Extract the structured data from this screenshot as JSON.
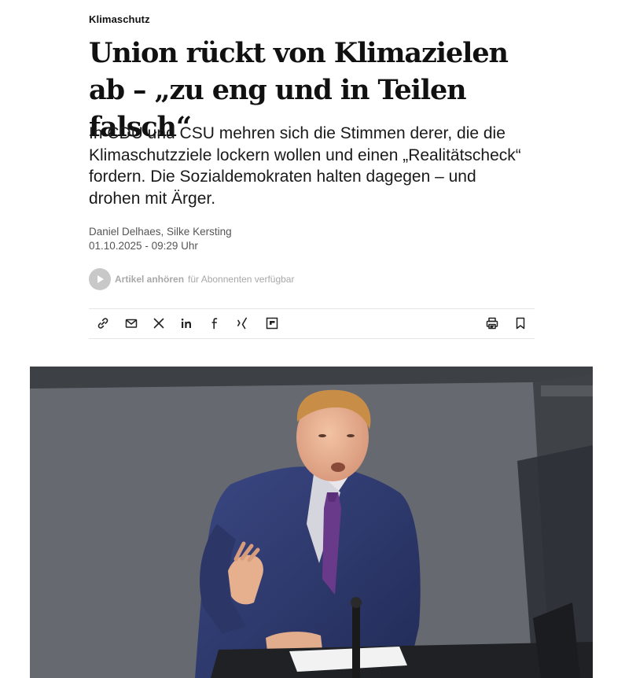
{
  "article": {
    "kicker": "Klimaschutz",
    "headline": "Union rückt von Klimazielen ab – „zu eng und in Teilen falsch“",
    "teaser": "In CDU und CSU mehren sich die Stimmen derer, die die Klimaschutzziele lockern wollen und einen „Realitätscheck“ fordern. Die Sozialdemokraten halten dagegen – und drohen mit Ärger.",
    "authors": "Daniel Delhaes, Silke Kersting",
    "date": "01.10.2025 - 09:29 Uhr"
  },
  "audio": {
    "label": "Artikel anhören",
    "note": "für Abonnenten verfügbar",
    "icon": "play-icon"
  },
  "share_bar": {
    "icons": [
      "link-icon",
      "mail-icon",
      "x-icon",
      "linkedin-icon",
      "facebook-icon",
      "xing-icon",
      "flipboard-icon"
    ],
    "right_icons": [
      "print-icon",
      "bookmark-icon"
    ]
  },
  "colors": {
    "text": "#111111",
    "meta": "#555555",
    "muted": "#a8a8a8",
    "divider": "#e6e6e6",
    "suit": "#2f3c72"
  }
}
